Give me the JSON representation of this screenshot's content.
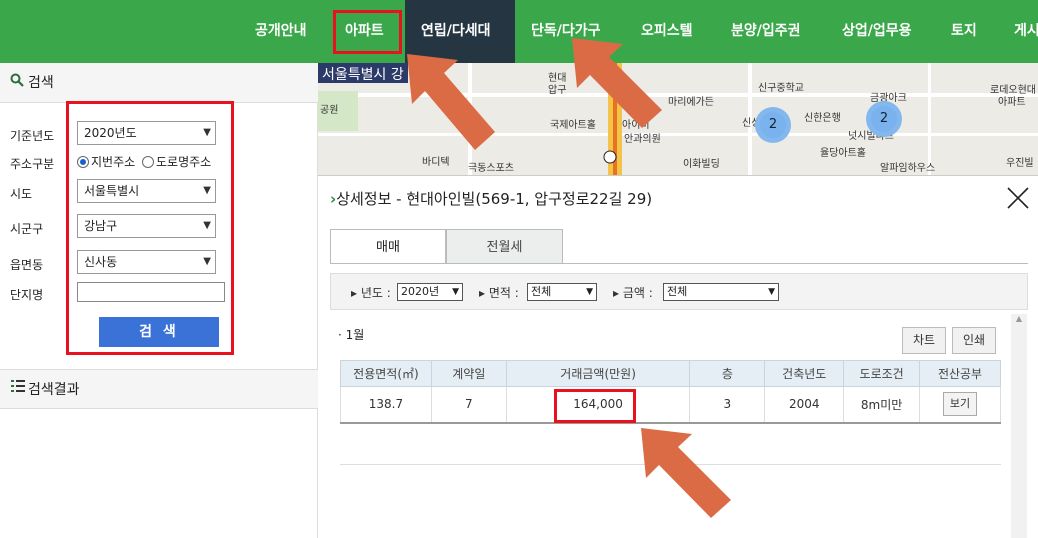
{
  "nav": {
    "items": [
      "공개안내",
      "아파트",
      "연립/다세대",
      "단독/다가구",
      "오피스텔",
      "분양/입주권",
      "상업/업무용",
      "토지",
      "게시"
    ],
    "active": "아파트"
  },
  "search_panel": {
    "title": "검색",
    "fields": {
      "year_label": "기준년도",
      "year_value": "2020년도",
      "addr_type_label": "주소구분",
      "addr_option_1": "지번주소",
      "addr_option_2": "도로명주소",
      "sido_label": "시도",
      "sido_value": "서울특별시",
      "sigungu_label": "시군구",
      "sigungu_value": "강남구",
      "eup_label": "읍면동",
      "eup_value": "신사동",
      "complex_label": "단지명",
      "complex_value": ""
    },
    "search_button": "검 색"
  },
  "results_panel": {
    "title": "검색결과"
  },
  "map": {
    "region_title": "서울특별시 강",
    "labels": [
      "현대",
      "압구",
      "마리에가든",
      "신구중학교",
      "금광아크",
      "로데오현대",
      "아파트",
      "공원",
      "국제아트홀",
      "아이비",
      "안과의원",
      "신성아파트",
      "신한은행",
      "넛시빌라트",
      "바디텍",
      "극동스포츠",
      "이화빌딩",
      "율당아트홀",
      "알파임하우스",
      "우진빌"
    ],
    "clusters": [
      "2",
      "2"
    ]
  },
  "detail": {
    "title": "상세정보 - 현대아인빌(569-1, 압구정로22길 29)",
    "tabs": [
      "매매",
      "전월세"
    ],
    "filters": {
      "year_label": "년도 :",
      "year_value": "2020년",
      "area_label": "면적 :",
      "area_value": "전체",
      "price_label": "금액 :",
      "price_value": "전체"
    },
    "month": "· 1월",
    "chart_button": "차트",
    "print_button": "인쇄",
    "table": {
      "headers": [
        "전용면적(㎡)",
        "계약일",
        "거래금액(만원)",
        "층",
        "건축년도",
        "도로조건",
        "전산공부"
      ],
      "rows": [
        {
          "area": "138.7",
          "day": "7",
          "price": "164,000",
          "floor": "3",
          "built": "2004",
          "road": "8m미만",
          "doc": "보기"
        }
      ]
    }
  },
  "colors": {
    "nav_green": "#3aa74b",
    "nav_dark": "#253542",
    "highlight_red": "#e8121f",
    "arrow_orange": "#db6b45",
    "button_blue": "#3a72d8"
  }
}
